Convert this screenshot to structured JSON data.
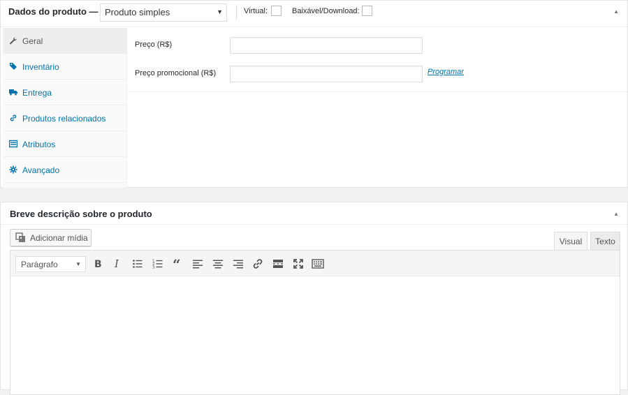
{
  "product_data": {
    "title": "Dados do produto —",
    "product_type": "Produto simples",
    "virtual_label": "Virtual:",
    "download_label": "Baixável/Download:",
    "toggle_icon": "triangle-up-icon"
  },
  "tabs": [
    {
      "label": "Geral",
      "icon": "wrench-icon",
      "active": true
    },
    {
      "label": "Inventário",
      "icon": "tag-icon"
    },
    {
      "label": "Entrega",
      "icon": "truck-icon"
    },
    {
      "label": "Produtos relacionados",
      "icon": "link-icon"
    },
    {
      "label": "Atributos",
      "icon": "list-icon"
    },
    {
      "label": "Avançado",
      "icon": "gear-icon"
    }
  ],
  "general": {
    "price_label": "Preço (R$)",
    "price_value": "",
    "sale_price_label": "Preço promocional (R$)",
    "sale_price_value": "",
    "schedule_link": "Programar"
  },
  "short_desc": {
    "title": "Breve descrição sobre o produto",
    "add_media": "Adicionar mídia",
    "tab_visual": "Visual",
    "tab_text": "Texto",
    "format_select": "Parágrafo",
    "toolbar": [
      "bold-icon",
      "italic-icon",
      "bullet-list-icon",
      "numbered-list-icon",
      "blockquote-icon",
      "align-left-icon",
      "align-center-icon",
      "align-right-icon",
      "link-icon",
      "read-more-icon",
      "fullscreen-icon",
      "kitchen-sink-icon"
    ],
    "content": ""
  },
  "colors": {
    "link": "#0073aa",
    "border": "#dddddd",
    "background": "#f1f1f1"
  }
}
